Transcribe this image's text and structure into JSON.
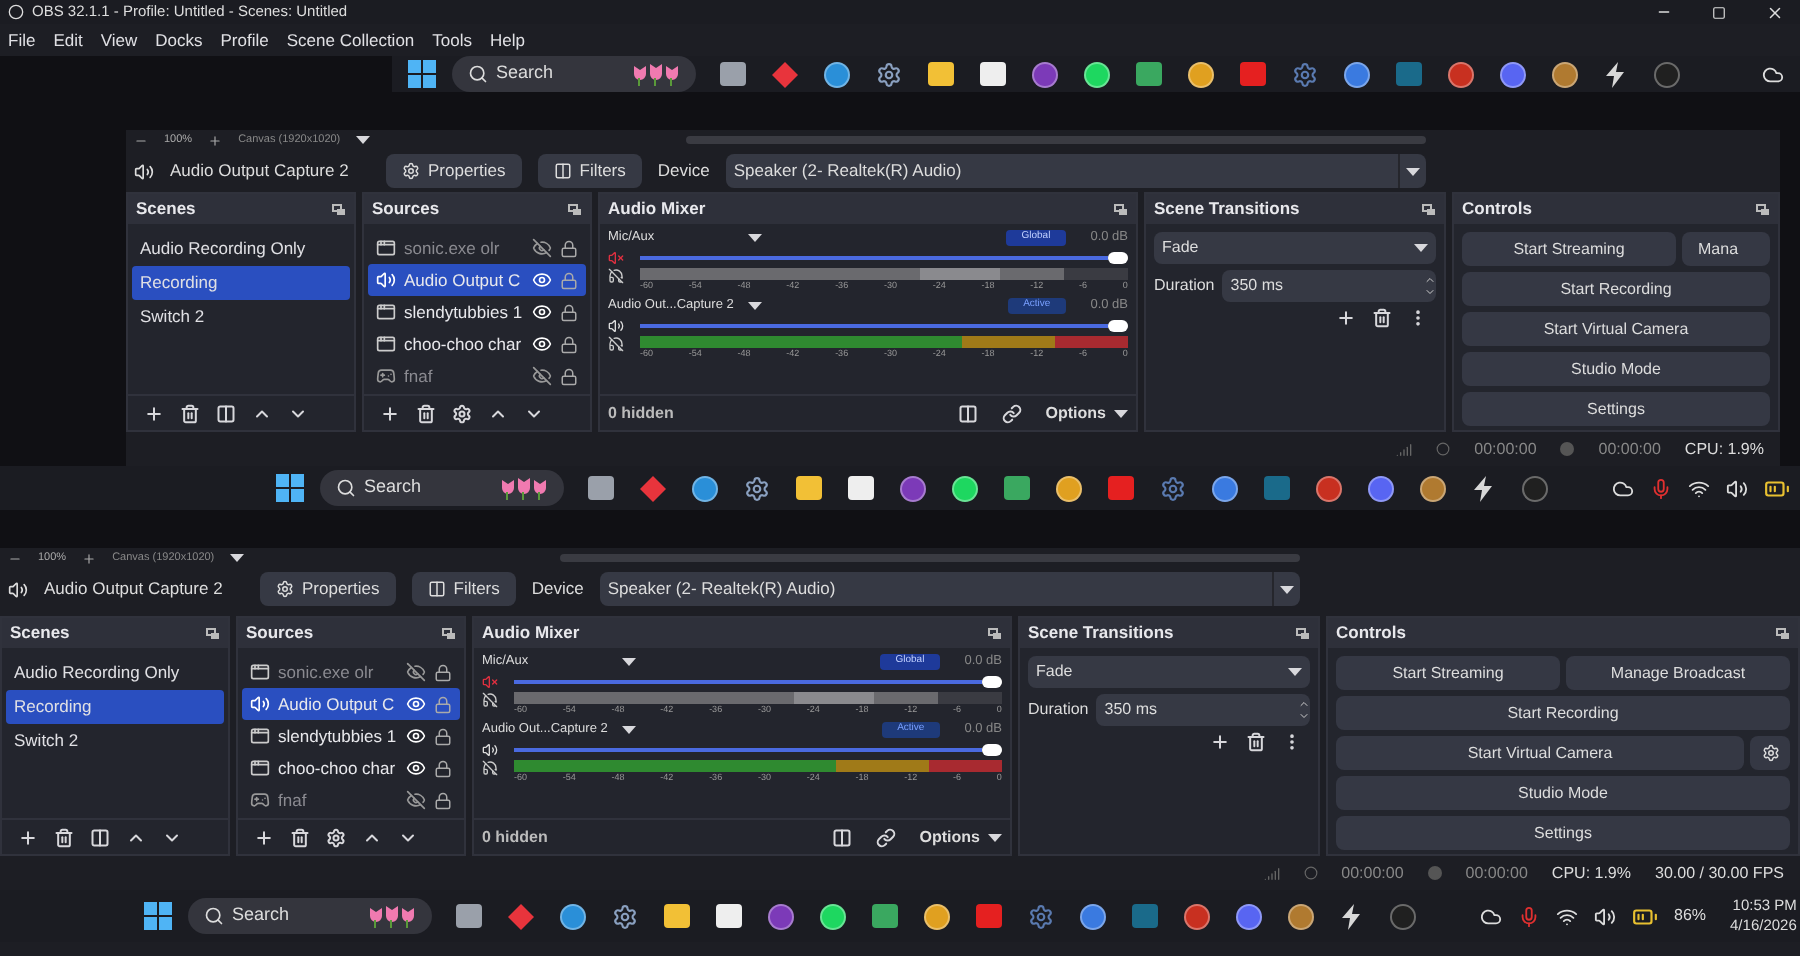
{
  "window": {
    "title": "OBS 32.1.1 - Profile: Untitled - Scenes: Untitled"
  },
  "menu": [
    "File",
    "Edit",
    "View",
    "Docks",
    "Profile",
    "Scene Collection",
    "Tools",
    "Help"
  ],
  "preview": {
    "top_taskbar": {
      "search": "Search"
    },
    "zoom_bar": {
      "zoom": "100%",
      "canvas": "Canvas (1920x1020)"
    },
    "source_bar": {
      "source": "Audio Output Capture 2",
      "properties": "Properties",
      "filters": "Filters",
      "device_label": "Device",
      "device": "Speaker (2- Realtek(R) Audio)"
    },
    "docks": {
      "scenes": {
        "title": "Scenes",
        "items": [
          {
            "name": "Audio Recording Only",
            "selected": false
          },
          {
            "name": "Recording",
            "selected": true
          },
          {
            "name": "Switch 2",
            "selected": false
          }
        ]
      },
      "sources": {
        "title": "Sources",
        "items": [
          {
            "name": "sonic.exe olr",
            "kind": "window",
            "visible": false,
            "selected": false
          },
          {
            "name": "Audio Output C",
            "kind": "audio",
            "visible": true,
            "selected": true
          },
          {
            "name": "slendytubbies 1",
            "kind": "window",
            "visible": true,
            "selected": false
          },
          {
            "name": "choo-choo char",
            "kind": "window",
            "visible": true,
            "selected": false
          },
          {
            "name": "fnaf",
            "kind": "game",
            "visible": false,
            "selected": false
          }
        ]
      },
      "mixer": {
        "title": "Audio Mixer",
        "hidden": "0 hidden",
        "options": "Options",
        "channels": [
          {
            "name": "Mic/Aux",
            "badge": "Global",
            "db": "0.0 dB",
            "muted": true,
            "active": false,
            "volume": {
              "level": 1
            },
            "meter": {
              "level": 0.87
            },
            "scale": [
              "-60",
              "-54",
              "-48",
              "-42",
              "-36",
              "-30",
              "-24",
              "-18",
              "-12",
              "-6",
              "0"
            ]
          },
          {
            "name": "Audio Out...Capture 2",
            "badge": "Active",
            "db": "0.0 dB",
            "muted": false,
            "active": true,
            "volume": {
              "level": 1
            },
            "meter": {
              "level": 1
            },
            "scale": [
              "-60",
              "-54",
              "-48",
              "-42",
              "-36",
              "-30",
              "-24",
              "-18",
              "-12",
              "-6",
              "0"
            ]
          }
        ]
      },
      "transitions": {
        "title": "Scene Transitions",
        "transition": "Fade",
        "duration_label": "Duration",
        "duration": "350 ms"
      },
      "controls": {
        "title": "Controls",
        "rows": [
          [
            {
              "label": "Start Streaming"
            },
            {
              "label": "Mana",
              "cut": true
            }
          ],
          [
            {
              "label": "Start Recording"
            }
          ],
          [
            {
              "label": "Start Virtual Camera",
              "gear": false
            }
          ],
          [
            {
              "label": "Studio Mode"
            }
          ],
          [
            {
              "label": "Settings"
            }
          ]
        ]
      }
    },
    "status_bar": {
      "stream_time": "00:00:00",
      "rec_time": "00:00:00",
      "cpu": "CPU: 1.9%"
    },
    "taskbar": {
      "search": "Search"
    }
  },
  "zoom_bar": {
    "zoom": "100%",
    "canvas": "Canvas (1920x1020)"
  },
  "source_bar": {
    "source": "Audio Output Capture 2",
    "properties": "Properties",
    "filters": "Filters",
    "device_label": "Device",
    "device": "Speaker (2- Realtek(R) Audio)"
  },
  "docks": {
    "scenes": {
      "title": "Scenes",
      "items": [
        {
          "name": "Audio Recording Only",
          "selected": false
        },
        {
          "name": "Recording",
          "selected": true
        },
        {
          "name": "Switch 2",
          "selected": false
        }
      ]
    },
    "sources": {
      "title": "Sources",
      "items": [
        {
          "name": "sonic.exe olr",
          "kind": "window",
          "visible": false,
          "selected": false
        },
        {
          "name": "Audio Output C",
          "kind": "audio",
          "visible": true,
          "selected": true
        },
        {
          "name": "slendytubbies 1",
          "kind": "window",
          "visible": true,
          "selected": false
        },
        {
          "name": "choo-choo char",
          "kind": "window",
          "visible": true,
          "selected": false
        },
        {
          "name": "fnaf",
          "kind": "game",
          "visible": false,
          "selected": false
        }
      ]
    },
    "mixer": {
      "title": "Audio Mixer",
      "hidden": "0 hidden",
      "options": "Options",
      "channels": [
        {
          "name": "Mic/Aux",
          "badge": "Global",
          "db": "0.0 dB",
          "muted": true,
          "active": false,
          "volume": {
            "level": 1
          },
          "meter": {
            "level": 0.87
          },
          "scale": [
            "-60",
            "-54",
            "-48",
            "-42",
            "-36",
            "-30",
            "-24",
            "-18",
            "-12",
            "-6",
            "0"
          ]
        },
        {
          "name": "Audio Out...Capture 2",
          "badge": "Active",
          "db": "0.0 dB",
          "muted": false,
          "active": true,
          "volume": {
            "level": 1
          },
          "meter": {
            "level": 1
          },
          "scale": [
            "-60",
            "-54",
            "-48",
            "-42",
            "-36",
            "-30",
            "-24",
            "-18",
            "-12",
            "-6",
            "0"
          ]
        }
      ]
    },
    "transitions": {
      "title": "Scene Transitions",
      "transition": "Fade",
      "duration_label": "Duration",
      "duration": "350 ms"
    },
    "controls": {
      "title": "Controls",
      "rows": [
        [
          {
            "label": "Start Streaming"
          },
          {
            "label": "Manage Broadcast"
          }
        ],
        [
          {
            "label": "Start Recording"
          }
        ],
        [
          {
            "label": "Start Virtual Camera",
            "gear": true
          }
        ],
        [
          {
            "label": "Studio Mode"
          }
        ],
        [
          {
            "label": "Settings"
          }
        ]
      ]
    }
  },
  "status_bar": {
    "stream_time": "00:00:00",
    "rec_time": "00:00:00",
    "cpu": "CPU: 1.9%",
    "fps": "30.00 / 30.00 FPS"
  },
  "taskbar": {
    "search": "Search",
    "battery": "86%",
    "time": "10:53 PM",
    "date": "4/16/2026"
  }
}
